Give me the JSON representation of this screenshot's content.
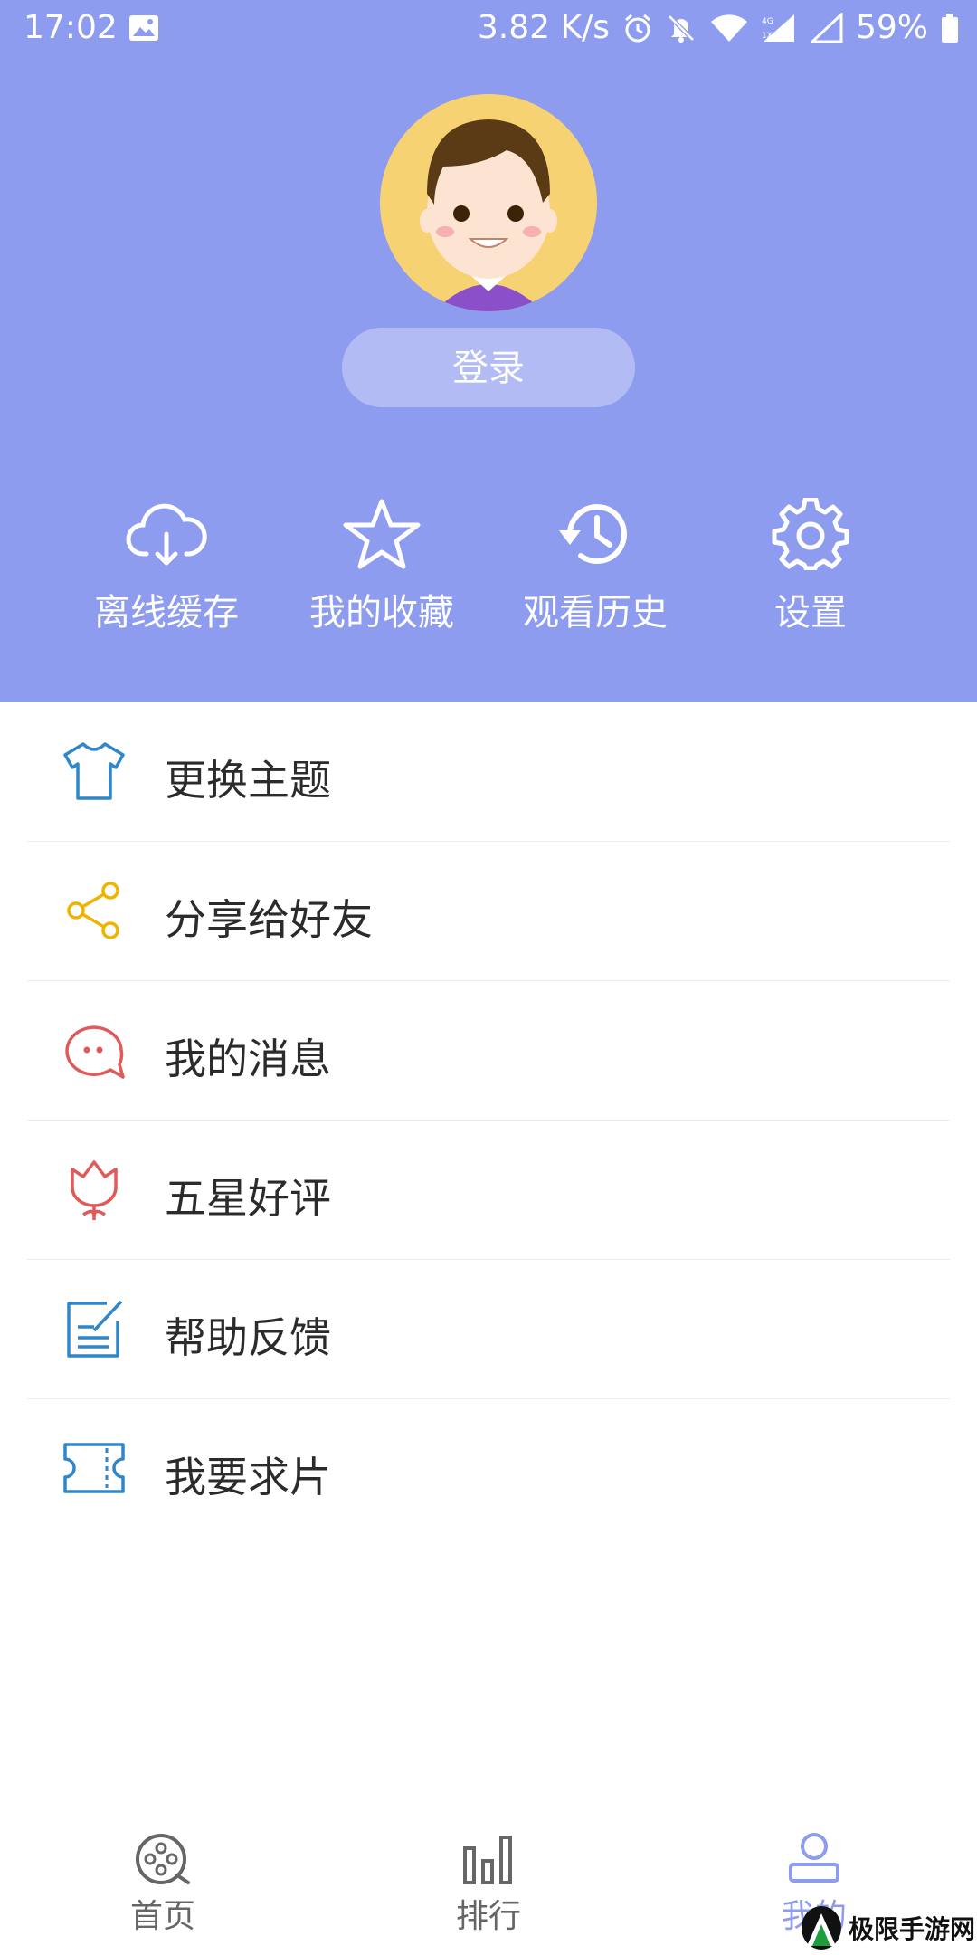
{
  "status_bar": {
    "time": "17:02",
    "network_speed": "3.82 K/s",
    "battery": "59%",
    "icons": [
      "image-icon",
      "alarm-icon",
      "bell-off-icon",
      "wifi-icon",
      "signal-icon",
      "battery-icon"
    ]
  },
  "profile": {
    "avatar": "boy-avatar",
    "login_label": "登录"
  },
  "quick_actions": [
    {
      "label": "离线缓存",
      "icon": "cloud-download-icon"
    },
    {
      "label": "我的收藏",
      "icon": "star-icon"
    },
    {
      "label": "观看历史",
      "icon": "history-icon"
    },
    {
      "label": "设置",
      "icon": "gear-icon"
    }
  ],
  "menu": [
    {
      "label": "更换主题",
      "icon": "tshirt-icon",
      "color": "#2f86c9"
    },
    {
      "label": "分享给好友",
      "icon": "share-icon",
      "color": "#f0b400"
    },
    {
      "label": "我的消息",
      "icon": "message-icon",
      "color": "#e05a5a"
    },
    {
      "label": "五星好评",
      "icon": "tulip-icon",
      "color": "#e05a5a"
    },
    {
      "label": "帮助反馈",
      "icon": "edit-icon",
      "color": "#2f86c9"
    },
    {
      "label": "我要求片",
      "icon": "ticket-icon",
      "color": "#2f86c9"
    }
  ],
  "tabs": [
    {
      "label": "首页",
      "icon": "film-reel-icon"
    },
    {
      "label": "排行",
      "icon": "bar-chart-icon"
    },
    {
      "label": "我的",
      "icon": "user-icon",
      "active": true
    }
  ],
  "colors": {
    "header_bg": "#8d9cef",
    "login_bg": "#b3bbf5",
    "active_tab": "#8d9cef"
  },
  "watermark": {
    "text": "极限手游网"
  }
}
